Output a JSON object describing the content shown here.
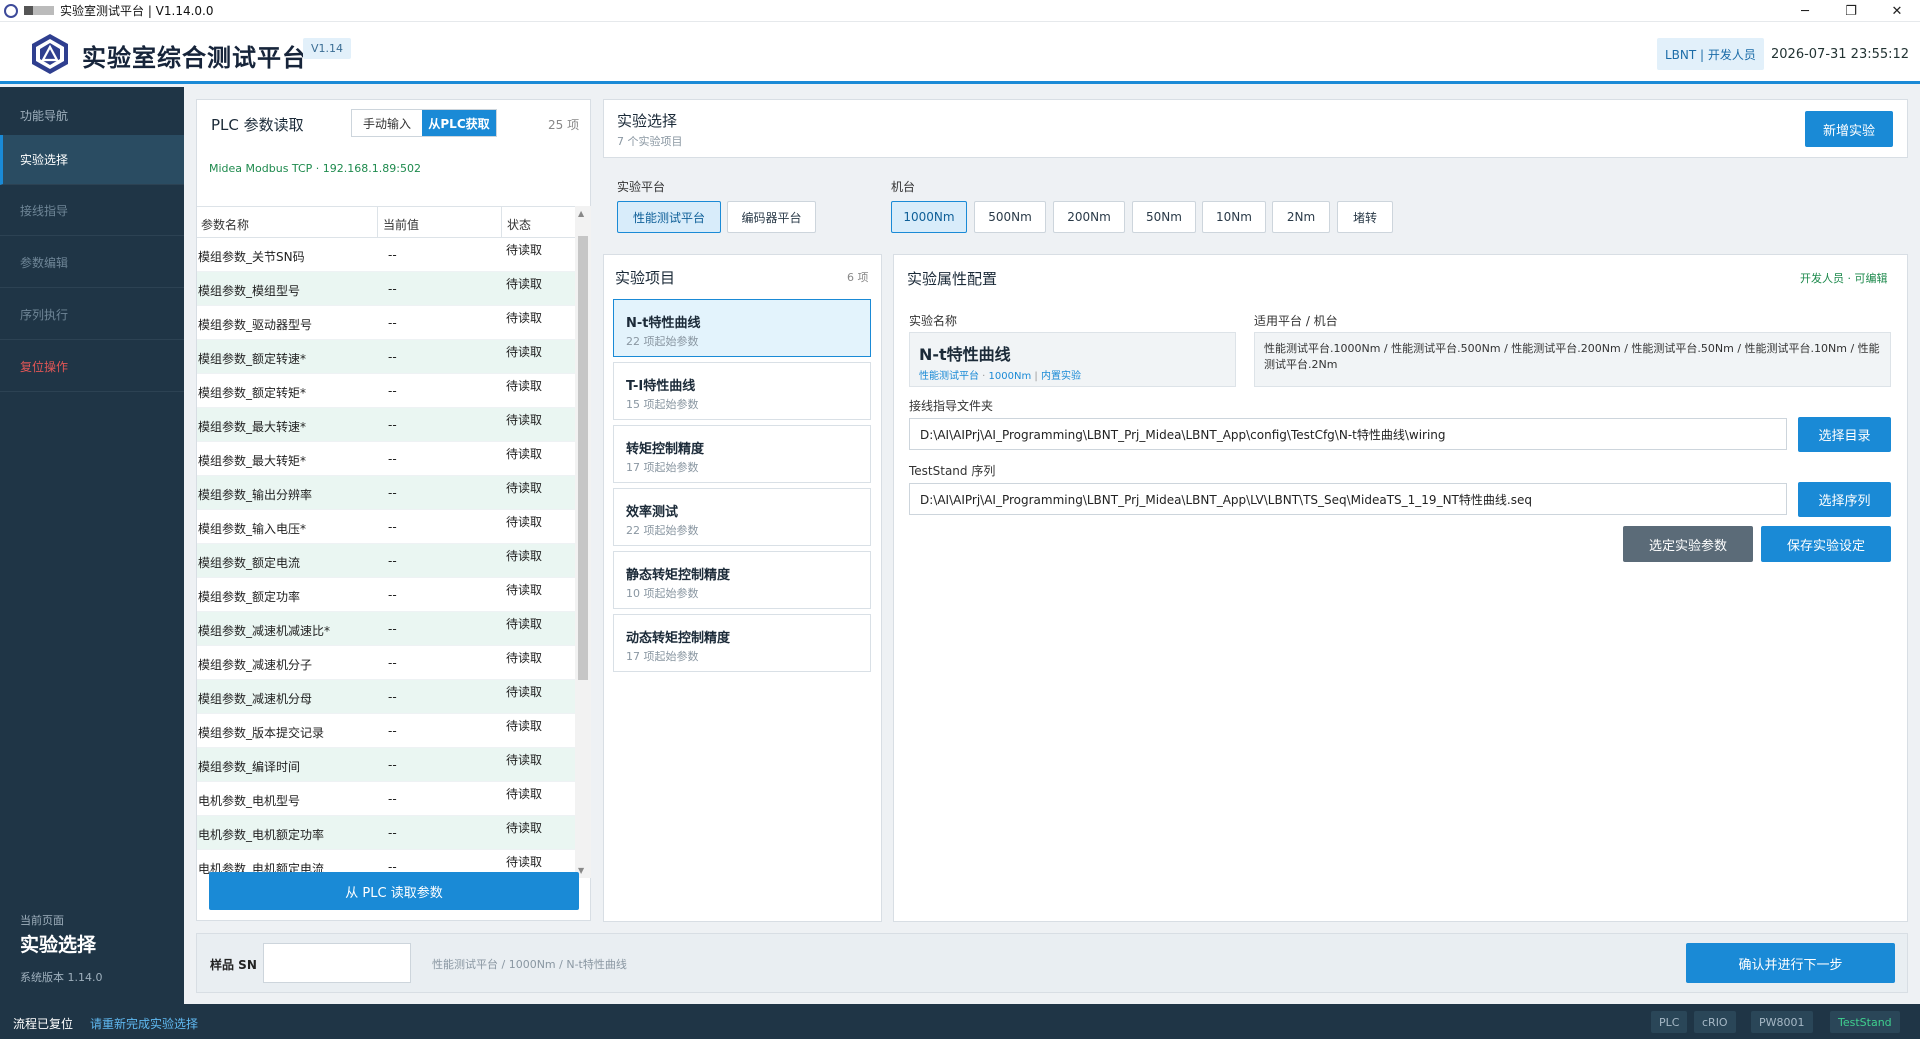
{
  "window": {
    "title": "实验室测试平台 | V1.14.0.0",
    "minimize": "─",
    "restore": "❐",
    "close": "✕"
  },
  "header": {
    "title": "实验室综合测试平台",
    "version": "V1.14",
    "user_badge": "LBNT | 开发人员",
    "datetime": "2026-07-31  23:55:12"
  },
  "sidebar": {
    "heading": "功能导航",
    "items": [
      {
        "label": "实验选择",
        "active": true
      },
      {
        "label": "接线指导"
      },
      {
        "label": "参数编辑"
      },
      {
        "label": "序列执行"
      },
      {
        "label": "复位操作"
      }
    ],
    "current_page_label": "当前页面",
    "current_page": "实验选择",
    "system_version": "系统版本 1.14.0"
  },
  "plc": {
    "title": "PLC 参数读取",
    "tab_manual": "手动输入",
    "tab_plc": "从PLC获取",
    "count": "25 项",
    "connection": "Midea Modbus TCP · 192.168.1.89:502",
    "columns": [
      "参数名称",
      "当前值",
      "状态"
    ],
    "rows": [
      {
        "name": "模组参数_关节SN码",
        "value": "--",
        "status": "待读取"
      },
      {
        "name": "模组参数_模组型号",
        "value": "--",
        "status": "待读取"
      },
      {
        "name": "模组参数_驱动器型号",
        "value": "--",
        "status": "待读取"
      },
      {
        "name": "模组参数_额定转速*",
        "value": "--",
        "status": "待读取"
      },
      {
        "name": "模组参数_额定转矩*",
        "value": "--",
        "status": "待读取"
      },
      {
        "name": "模组参数_最大转速*",
        "value": "--",
        "status": "待读取"
      },
      {
        "name": "模组参数_最大转矩*",
        "value": "--",
        "status": "待读取"
      },
      {
        "name": "模组参数_输出分辨率",
        "value": "--",
        "status": "待读取"
      },
      {
        "name": "模组参数_输入电压*",
        "value": "--",
        "status": "待读取"
      },
      {
        "name": "模组参数_额定电流",
        "value": "--",
        "status": "待读取"
      },
      {
        "name": "模组参数_额定功率",
        "value": "--",
        "status": "待读取"
      },
      {
        "name": "模组参数_减速机减速比*",
        "value": "--",
        "status": "待读取"
      },
      {
        "name": "模组参数_减速机分子",
        "value": "--",
        "status": "待读取"
      },
      {
        "name": "模组参数_减速机分母",
        "value": "--",
        "status": "待读取"
      },
      {
        "name": "模组参数_版本提交记录",
        "value": "--",
        "status": "待读取"
      },
      {
        "name": "模组参数_编译时间",
        "value": "--",
        "status": "待读取"
      },
      {
        "name": "电机参数_电机型号",
        "value": "--",
        "status": "待读取"
      },
      {
        "name": "电机参数_电机额定功率",
        "value": "--",
        "status": "待读取"
      },
      {
        "name": "电机参数_电机额定电流",
        "value": "--",
        "status": "待读取"
      }
    ],
    "read_button": "从 PLC 读取参数"
  },
  "experiment": {
    "title": "实验选择",
    "subtitle": "7 个实验项目",
    "new_button": "新增实验",
    "platform_label": "实验平台",
    "platforms": [
      {
        "label": "性能测试平台",
        "selected": true
      },
      {
        "label": "编码器平台"
      }
    ],
    "machine_label": "机台",
    "machines": [
      {
        "label": "1000Nm",
        "selected": true
      },
      {
        "label": "500Nm"
      },
      {
        "label": "200Nm"
      },
      {
        "label": "50Nm"
      },
      {
        "label": "10Nm"
      },
      {
        "label": "2Nm"
      },
      {
        "label": "堵转"
      }
    ]
  },
  "projects": {
    "title": "实验项目",
    "count": "6 项",
    "items": [
      {
        "name": "N-t特性曲线",
        "count": "22 项起始参数",
        "selected": true
      },
      {
        "name": "T-I特性曲线",
        "count": "15 项起始参数"
      },
      {
        "name": "转矩控制精度",
        "count": "17 项起始参数"
      },
      {
        "name": "效率测试",
        "count": "22 项起始参数"
      },
      {
        "name": "静态转矩控制精度",
        "count": "10 项起始参数"
      },
      {
        "name": "动态转矩控制精度",
        "count": "17 项起始参数"
      }
    ]
  },
  "config": {
    "title": "实验属性配置",
    "edit_hint": "开发人员 · 可编辑",
    "name_label": "实验名称",
    "name_value": "N-t特性曲线",
    "name_meta_platform": "性能测试平台",
    "name_meta_machine": "1000Nm",
    "name_meta_builtin": "内置实验",
    "platform_label": "适用平台 / 机台",
    "platform_value": "性能测试平台.1000Nm / 性能测试平台.500Nm / 性能测试平台.200Nm / 性能测试平台.50Nm / 性能测试平台.10Nm / 性能测试平台.2Nm",
    "wiring_label": "接线指导文件夹",
    "wiring_value": "D:\\AI\\AIPrj\\AI_Programming\\LBNT_Prj_Midea\\LBNT_App\\config\\TestCfg\\N-t特性曲线\\wiring",
    "choose_dir": "选择目录",
    "seq_label": "TestStand 序列",
    "seq_value": "D:\\AI\\AIPrj\\AI_Programming\\LBNT_Prj_Midea\\LBNT_App\\LV\\LBNT\\TS_Seq\\MideaTS_1_19_NT特性曲线.seq",
    "choose_seq": "选择序列",
    "select_params": "选定实验参数",
    "save_settings": "保存实验设定"
  },
  "bottom": {
    "sn_label": "样品 SN",
    "sn_value": "",
    "breadcrumb": [
      "性能测试平台",
      "1000Nm",
      "N-t特性曲线"
    ],
    "confirm_button": "确认并进行下一步"
  },
  "statusbar": {
    "state": "流程已复位",
    "hint": "请重新完成实验选择",
    "tags": [
      "PLC",
      "cRIO",
      "PW8001",
      "TestStand"
    ]
  },
  "colors": {
    "accent": "#1a8ad6",
    "sidebar": "#1f3546",
    "danger": "#e25656",
    "ok_tag": "#3fcf8e"
  }
}
